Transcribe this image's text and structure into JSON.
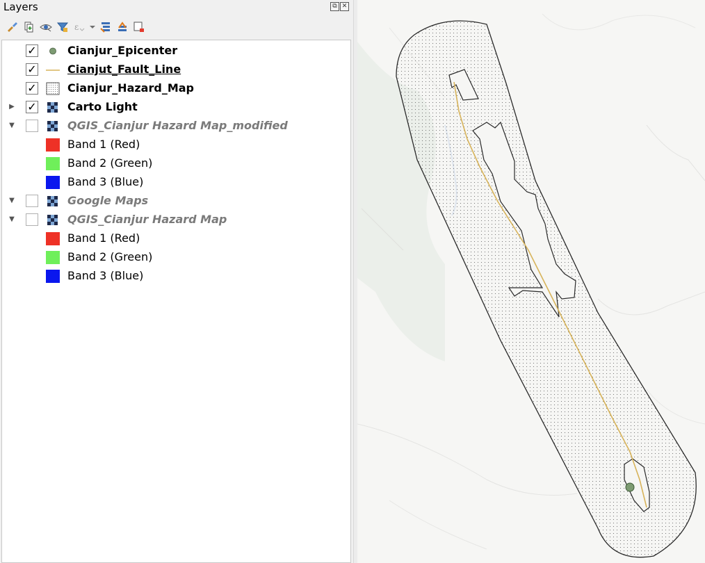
{
  "panel": {
    "title": "Layers",
    "dock_buttons": [
      "⧉",
      "✕"
    ]
  },
  "toolbar": {
    "icons": [
      "style-manager-icon",
      "add-group-icon",
      "visibility-icon",
      "filter-legend-icon",
      "filter-expression-icon",
      "expand-all-icon",
      "collapse-all-icon",
      "remove-layer-icon"
    ]
  },
  "layers": [
    {
      "name": "Cianjur_Epicenter",
      "checked": true,
      "style": "bold",
      "symbol": "point"
    },
    {
      "name": "Cianjut_Fault_Line",
      "checked": true,
      "style": "bold-underline",
      "symbol": "line"
    },
    {
      "name": "Cianjur_Hazard_Map",
      "checked": true,
      "style": "bold",
      "symbol": "polygon-dots"
    },
    {
      "name": "Carto Light",
      "checked": true,
      "style": "bold",
      "symbol": "raster",
      "expander": "collapsed"
    },
    {
      "name": "QGIS_Cianjur Hazard Map_modified",
      "checked": false,
      "style": "grey",
      "symbol": "raster",
      "expander": "expanded"
    },
    {
      "name": "Band 1 (Red)",
      "legend_color": "#ee3126"
    },
    {
      "name": "Band 2 (Green)",
      "legend_color": "#6fef5a"
    },
    {
      "name": "Band 3 (Blue)",
      "legend_color": "#0a17ee"
    },
    {
      "name": "Google Maps",
      "checked": false,
      "style": "grey",
      "symbol": "raster",
      "expander": "expanded"
    },
    {
      "name": "QGIS_Cianjur Hazard Map",
      "checked": false,
      "style": "grey",
      "symbol": "raster",
      "expander": "expanded"
    },
    {
      "name": "Band 1 (Red)",
      "legend_color": "#ee3126"
    },
    {
      "name": "Band 2 (Green)",
      "legend_color": "#6fef5a"
    },
    {
      "name": "Band 3 (Blue)",
      "legend_color": "#0a17ee"
    }
  ],
  "map": {
    "epicenter_color": "#7d9b72",
    "fault_line_color": "#d7b35a",
    "hazard_outline_color": "#2a2a2a"
  }
}
